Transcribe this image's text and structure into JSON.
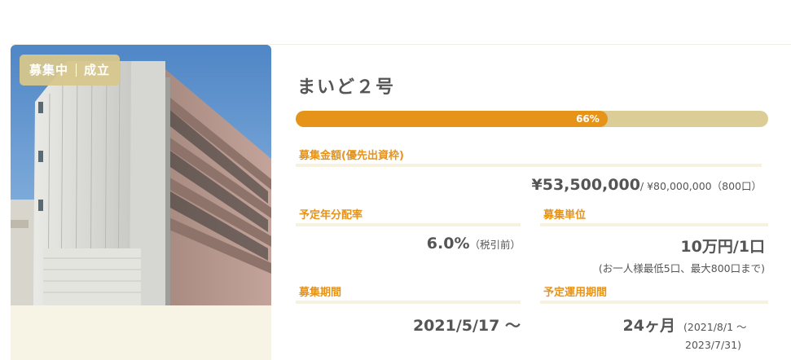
{
  "fund": {
    "status_badge": {
      "left": "募集中",
      "right": "成立"
    },
    "name": "まいど２号",
    "progress": {
      "percent": 66,
      "label": "66%"
    },
    "offering_amount": {
      "label": "募集金額(優先出資枠)",
      "raised": "¥53,500,000",
      "total": "/ ¥80,000,000（800口）"
    },
    "expected_yield": {
      "label": "予定年分配率",
      "value": "6.0%",
      "note": "（税引前）"
    },
    "investment_unit": {
      "label": "募集単位",
      "value": "10万円/1口",
      "note": "(お一人様最低5口、最大800口まで)"
    },
    "offering_period": {
      "label": "募集期間",
      "value": "2021/5/17 〜"
    },
    "operation_period": {
      "label": "予定運用期間",
      "value": "24ヶ月",
      "dates_line1": "(2021/8/1 〜",
      "dates_line2": "2023/7/31)"
    }
  },
  "colors": {
    "accent_orange": "#e6931a",
    "progress_track": "#dccd96",
    "badge_bg": "#d6c78c",
    "panel_cream": "#f7f4e6",
    "text": "#555555"
  }
}
